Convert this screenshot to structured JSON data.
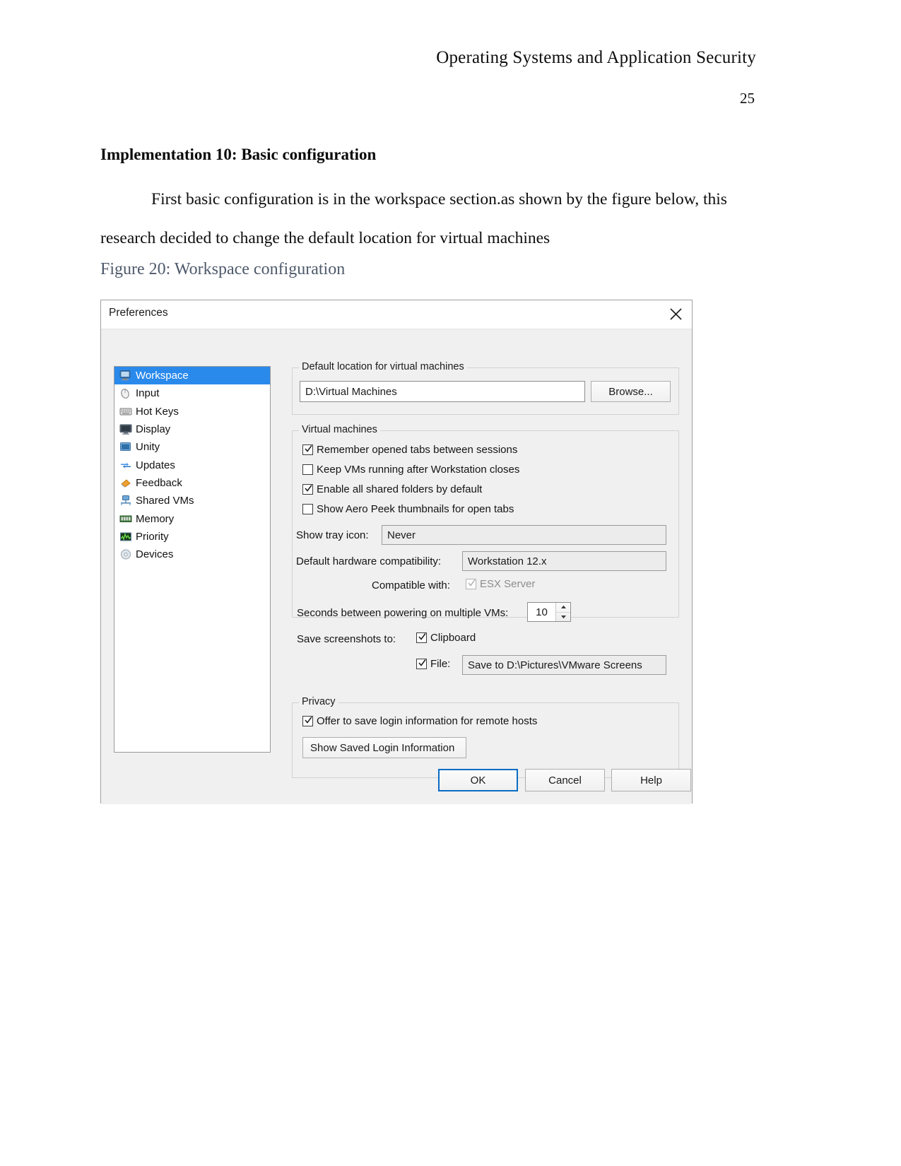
{
  "document": {
    "header": "Operating Systems and Application Security",
    "page_number": "25",
    "heading": "Implementation 10: Basic configuration",
    "paragraph_indent": "First basic configuration is in the workspace section.as shown by the figure below, this",
    "paragraph_rest": "research decided to change the default location for virtual machines",
    "figure_caption": "Figure 20: Workspace configuration",
    "caption_color": "#4e5a6b"
  },
  "dialog": {
    "title": "Preferences",
    "close_icon": "close-icon",
    "sidebar": {
      "items": [
        {
          "label": "Workspace",
          "icon": "monitor-icon",
          "selected": true
        },
        {
          "label": "Input",
          "icon": "mouse-icon",
          "selected": false
        },
        {
          "label": "Hot Keys",
          "icon": "keyboard-icon",
          "selected": false
        },
        {
          "label": "Display",
          "icon": "display-icon",
          "selected": false
        },
        {
          "label": "Unity",
          "icon": "unity-window-icon",
          "selected": false
        },
        {
          "label": "Updates",
          "icon": "refresh-arrows-icon",
          "selected": false
        },
        {
          "label": "Feedback",
          "icon": "megaphone-icon",
          "selected": false
        },
        {
          "label": "Shared VMs",
          "icon": "shared-vms-icon",
          "selected": false
        },
        {
          "label": "Memory",
          "icon": "memory-stick-icon",
          "selected": false
        },
        {
          "label": "Priority",
          "icon": "priority-graph-icon",
          "selected": false
        },
        {
          "label": "Devices",
          "icon": "disc-icon",
          "selected": false
        }
      ],
      "selected_color": "#2a8aec"
    },
    "location_group": {
      "legend": "Default location for virtual machines",
      "path_value": "D:\\Virtual Machines",
      "browse_label": "Browse..."
    },
    "vm_group": {
      "legend": "Virtual machines",
      "checkboxes": [
        {
          "label": "Remember opened tabs between sessions",
          "checked": true,
          "disabled": false
        },
        {
          "label": "Keep VMs running after Workstation closes",
          "checked": false,
          "disabled": false
        },
        {
          "label": "Enable all shared folders by default",
          "checked": true,
          "disabled": false
        },
        {
          "label": "Show Aero Peek thumbnails for open tabs",
          "checked": false,
          "disabled": false
        }
      ],
      "tray_icon_label": "Show tray icon:",
      "tray_icon_value": "Never",
      "hardware_label": "Default hardware compatibility:",
      "hardware_value": "Workstation 12.x",
      "compatible_label": "Compatible with:",
      "compatible_value": "ESX Server",
      "compatible_checked": true,
      "compatible_disabled": true,
      "seconds_label": "Seconds between powering on multiple VMs:",
      "seconds_value": "10",
      "screenshots_label": "Save screenshots to:",
      "clipboard_label": "Clipboard",
      "clipboard_checked": true,
      "file_label": "File:",
      "file_checked": true,
      "file_value": "Save to D:\\Pictures\\VMware Screens"
    },
    "privacy_group": {
      "legend": "Privacy",
      "offer_label": "Offer to save login information for remote hosts",
      "offer_checked": true,
      "show_saved_label": "Show Saved Login Information"
    },
    "footer": {
      "ok_label": "OK",
      "cancel_label": "Cancel",
      "help_label": "Help",
      "focus_color": "#0a6cc4"
    }
  }
}
